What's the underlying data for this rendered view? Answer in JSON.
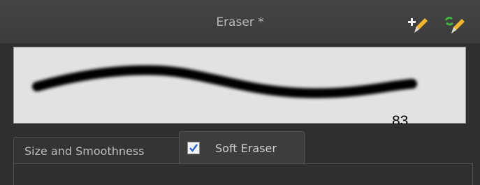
{
  "title": "Eraser *",
  "toolbar": {
    "new_preset_icon": "pencil-plus-icon",
    "rename_preset_icon": "pencil-refresh-icon"
  },
  "preview": {
    "size_value": "83"
  },
  "tabs": [
    {
      "label": "Size and Smoothness"
    },
    {
      "label": "Soft Eraser",
      "checked": true
    }
  ],
  "colors": {
    "background": "#2f2f2f",
    "preview_bg": "#e2e2e2",
    "stroke": "#000000",
    "pencil_yellow": "#f2b530",
    "checkbox_blue": "#2a5fd0"
  }
}
